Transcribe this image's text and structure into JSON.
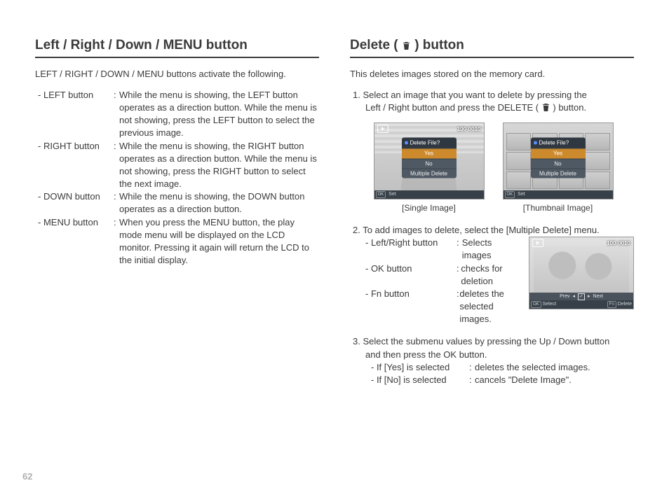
{
  "pageNumber": "62",
  "left": {
    "heading": "Left / Right / Down / MENU button",
    "intro": "LEFT / RIGHT / DOWN / MENU buttons activate the following.",
    "items": [
      {
        "label": "- LEFT button",
        "sep": ":",
        "body": "While the menu is showing, the LEFT button operates as a direction button. While the menu is not showing, press the LEFT button to select the previous image."
      },
      {
        "label": "- RIGHT button",
        "sep": ":",
        "body": "While the menu is showing, the RIGHT button operates as a direction button. While the menu is not showing, press the RIGHT button to select the next image."
      },
      {
        "label": "- DOWN button",
        "sep": ":",
        "body": "While the menu is showing, the DOWN button operates as a direction button."
      },
      {
        "label": "- MENU button",
        "sep": ":",
        "body": "When you press the MENU button, the play mode menu will be displayed on the LCD monitor. Pressing it again will return the LCD to the initial display."
      }
    ]
  },
  "right": {
    "heading_pre": "Delete (",
    "heading_post": ") button",
    "intro": "This deletes images stored on the memory card.",
    "step1": {
      "line1": "1. Select an image that you want to delete by pressing the",
      "line2_pre": "Left / Right button and press the DELETE (",
      "line2_post": ") button."
    },
    "screens": {
      "counter": "100-0010",
      "dialog_title": "Delete File?",
      "opt_yes": "Yes",
      "opt_no": "No",
      "opt_multi": "Multiple Delete",
      "ok": "OK",
      "set": "Set",
      "fn": "Fn",
      "select": "Select",
      "delete": "Delete",
      "prev": "Prev",
      "next": "Next",
      "left_arrow": "◂",
      "right_arrow": "▸",
      "check": "✓",
      "caption_single": "[Single Image]",
      "caption_thumb": "[Thumbnail Image]"
    },
    "step2": {
      "lead": "2. To add images to delete, select the [Multiple Delete] menu.",
      "subs": [
        {
          "l": "- Left/Right button",
          "s": ":",
          "b": "Selects images"
        },
        {
          "l": "- OK button",
          "s": ":",
          "b": "checks for deletion"
        },
        {
          "l": "- Fn button",
          "s": ":",
          "b": "deletes the selected images."
        }
      ]
    },
    "step3": {
      "l1": "3. Select the submenu values by pressing the Up / Down button",
      "l2": "and then press the OK button.",
      "subs": [
        {
          "l": "- If [Yes] is selected",
          "s": ":",
          "b": "deletes the selected images."
        },
        {
          "l": "- If [No] is selected",
          "s": ":",
          "b": "cancels \"Delete Image\"."
        }
      ]
    }
  }
}
